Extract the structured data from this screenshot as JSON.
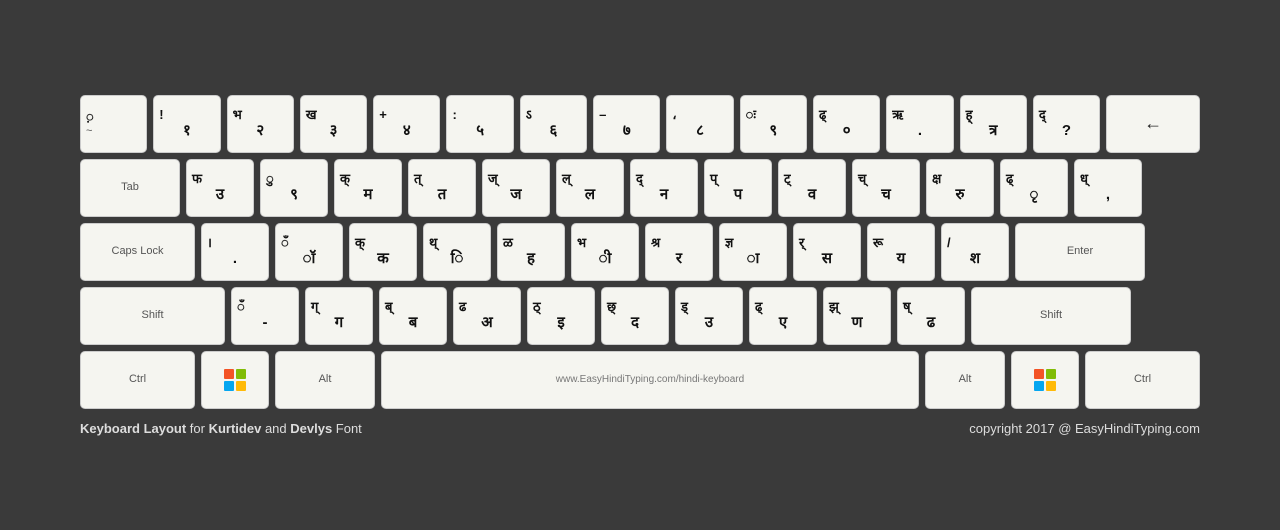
{
  "keyboard": {
    "title": "Keyboard Layout for Kurtidev and Devlys Font",
    "copyright": "copyright 2017 @ EasyHindiTyping.com",
    "url": "www.EasyHindiTyping.com/hindi-keyboard",
    "rows": [
      [
        {
          "label": "~",
          "hindi": "़",
          "width": "key-1u"
        },
        {
          "label": "!",
          "hindi": "१",
          "width": "key-1u"
        },
        {
          "label": "भ",
          "hindi": "२",
          "width": "key-1u"
        },
        {
          "label": "ख",
          "hindi": "३",
          "width": "key-1u"
        },
        {
          "label": "+",
          "hindi": "४",
          "width": "key-1u"
        },
        {
          "label": ":",
          "hindi": "५",
          "width": "key-1u"
        },
        {
          "label": "ऽ",
          "hindi": "६",
          "width": "key-1u"
        },
        {
          "label": "–",
          "hindi": "७",
          "width": "key-1u"
        },
        {
          "label": "،",
          "hindi": "८",
          "width": "key-1u"
        },
        {
          "label": "ः",
          "hindi": "९",
          "width": "key-1u"
        },
        {
          "label": "ढ्",
          "hindi": "०",
          "width": "key-1u"
        },
        {
          "label": "ऋ",
          "hindi": ".",
          "width": "key-1u"
        },
        {
          "label": "ह्",
          "hindi": "त्र",
          "width": "key-1u"
        },
        {
          "label": "द्",
          "hindi": "?",
          "width": "key-1u"
        },
        {
          "label": "←",
          "hindi": "",
          "width": "key-backspace"
        }
      ],
      [
        {
          "label": "Tab",
          "hindi": "",
          "width": "key-tab"
        },
        {
          "label": "फ",
          "hindi": "उ",
          "width": "key-1u"
        },
        {
          "label": "ु",
          "hindi": "९",
          "width": "key-1u"
        },
        {
          "label": "क्",
          "hindi": "म",
          "width": "key-1u"
        },
        {
          "label": "त्",
          "hindi": "त",
          "width": "key-1u"
        },
        {
          "label": "ज्",
          "hindi": "ज",
          "width": "key-1u"
        },
        {
          "label": "ल्",
          "hindi": "ल",
          "width": "key-1u"
        },
        {
          "label": "द्",
          "hindi": "न",
          "width": "key-1u"
        },
        {
          "label": "प्",
          "hindi": "प",
          "width": "key-1u"
        },
        {
          "label": "ट्",
          "hindi": "व",
          "width": "key-1u"
        },
        {
          "label": "च्",
          "hindi": "च",
          "width": "key-1u"
        },
        {
          "label": "क्ष",
          "hindi": "रु",
          "width": "key-1u"
        },
        {
          "label": "ढ्",
          "hindi": "ृ",
          "width": "key-1u"
        },
        {
          "label": "ध्",
          "hindi": ",",
          "width": "key-1u"
        }
      ],
      [
        {
          "label": "Caps Lock",
          "hindi": "",
          "width": "key-caps"
        },
        {
          "label": "।",
          "hindi": ".",
          "width": "key-1u"
        },
        {
          "label": "ँ",
          "hindi": "ॉ",
          "width": "key-1u"
        },
        {
          "label": "क्",
          "hindi": "क",
          "width": "key-1u"
        },
        {
          "label": "थ्",
          "hindi": "ि",
          "width": "key-1u"
        },
        {
          "label": "ळ",
          "hindi": "ह",
          "width": "key-1u"
        },
        {
          "label": "भ",
          "hindi": "ी",
          "width": "key-1u"
        },
        {
          "label": "श्र",
          "hindi": "र",
          "width": "key-1u"
        },
        {
          "label": "ज्ञ",
          "hindi": "ा",
          "width": "key-1u"
        },
        {
          "label": "र्",
          "hindi": "स",
          "width": "key-1u"
        },
        {
          "label": "रू",
          "hindi": "य",
          "width": "key-1u"
        },
        {
          "label": "/",
          "hindi": "श",
          "width": "key-1u"
        },
        {
          "label": "Enter",
          "hindi": "",
          "width": "key-enter"
        }
      ],
      [
        {
          "label": "Shift",
          "hindi": "",
          "width": "key-shift-l"
        },
        {
          "label": "ँ",
          "hindi": "-",
          "width": "key-1u"
        },
        {
          "label": "ग्",
          "hindi": "ग",
          "width": "key-1u"
        },
        {
          "label": "ब्",
          "hindi": "ब",
          "width": "key-1u"
        },
        {
          "label": "ढ",
          "hindi": "अ",
          "width": "key-1u"
        },
        {
          "label": "ठ्",
          "hindi": "इ",
          "width": "key-1u"
        },
        {
          "label": "छ्",
          "hindi": "द",
          "width": "key-1u"
        },
        {
          "label": "ड्",
          "hindi": "उ",
          "width": "key-1u"
        },
        {
          "label": "ढ्",
          "hindi": "ए",
          "width": "key-1u"
        },
        {
          "label": "झ्",
          "hindi": "ण",
          "width": "key-1u"
        },
        {
          "label": "ष्",
          "hindi": "ढ",
          "width": "key-1u"
        },
        {
          "label": "Shift",
          "hindi": "",
          "width": "key-shift-r"
        }
      ],
      [
        {
          "label": "Ctrl",
          "hindi": "",
          "width": "key-ctrl"
        },
        {
          "label": "win",
          "hindi": "",
          "width": "key-win"
        },
        {
          "label": "Alt",
          "hindi": "",
          "width": "key-alt"
        },
        {
          "label": "www.EasyHindiTyping.com/hindi-keyboard",
          "hindi": "",
          "width": "key-space"
        },
        {
          "label": "Alt",
          "hindi": "",
          "width": "key-alt-r"
        },
        {
          "label": "win2",
          "hindi": "",
          "width": "key-win"
        },
        {
          "label": "Ctrl",
          "hindi": "",
          "width": "key-ctrl"
        }
      ]
    ]
  }
}
